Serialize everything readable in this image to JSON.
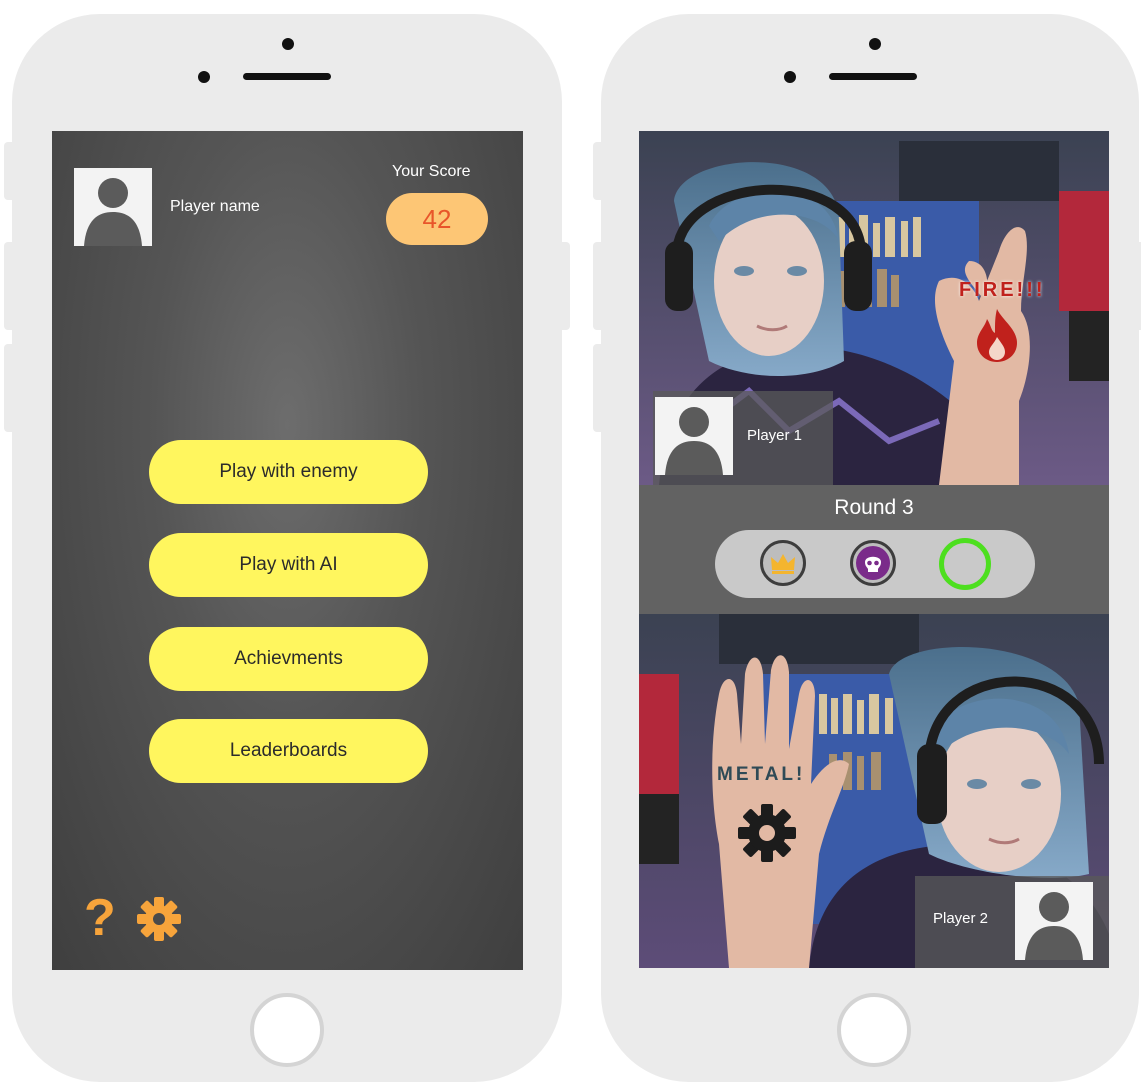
{
  "menu_screen": {
    "player_name": "Player name",
    "score_label": "Your Score",
    "score_value": "42",
    "buttons": [
      {
        "label": "Play with enemy"
      },
      {
        "label": "Play with AI"
      },
      {
        "label": "Achievments"
      },
      {
        "label": "Leaderboards"
      }
    ],
    "help_glyph": "?",
    "icons": [
      "avatar-icon",
      "help-icon",
      "gear-icon"
    ]
  },
  "game_screen": {
    "round_label": "Round 3",
    "player1": {
      "name": "Player 1",
      "gesture": "FIRE!!!",
      "gesture_icon": "fire-icon"
    },
    "player2": {
      "name": "Player 2",
      "gesture": "METAL!",
      "gesture_icon": "gear-icon"
    },
    "round_results": [
      {
        "result": "win",
        "icon": "crown-icon"
      },
      {
        "result": "loss",
        "icon": "skull-icon"
      },
      {
        "result": "pending",
        "icon": "empty-ring"
      }
    ]
  },
  "colors": {
    "button_yellow": "#fff65e",
    "score_pill": "#fdc675",
    "score_text": "#e8552a",
    "accent_orange": "#f7a43b",
    "pending_green": "#4ddf1f",
    "fire_red": "#c0211c"
  }
}
